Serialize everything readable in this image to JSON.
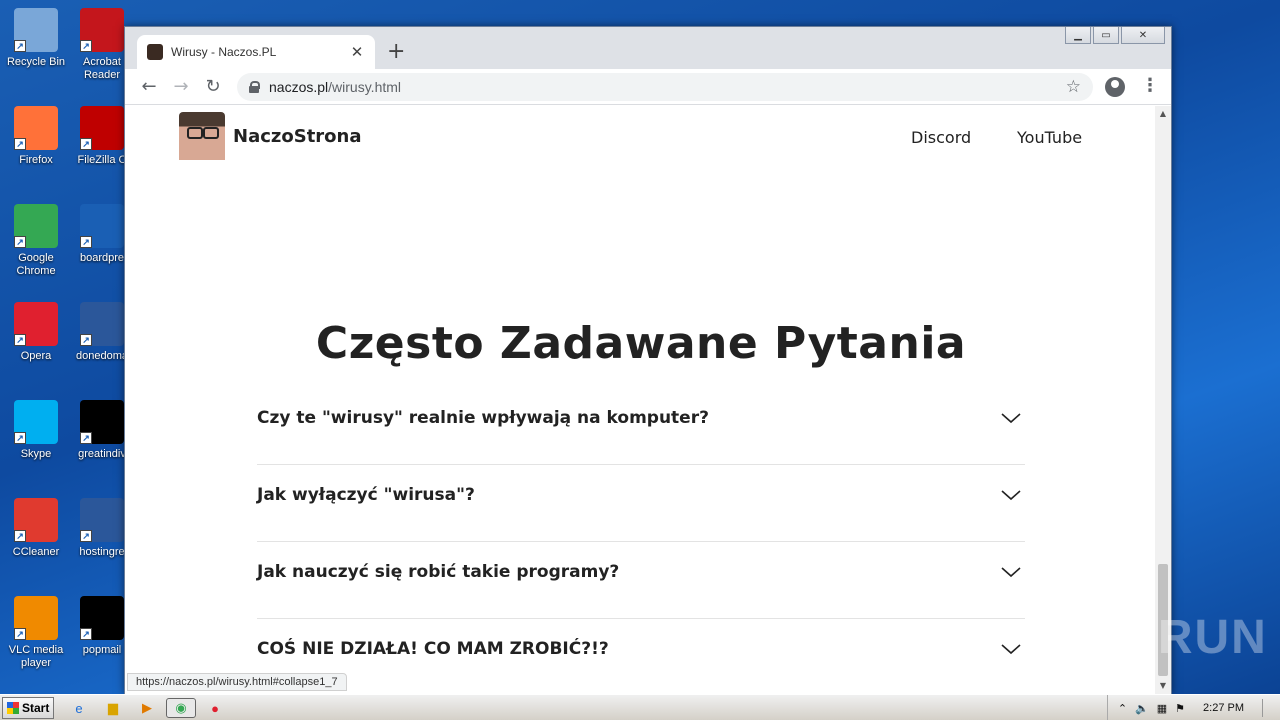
{
  "desktop": {
    "icons": [
      {
        "label": "Recycle Bin",
        "icon": "recycle-bin-icon",
        "color": "#7aa7d8"
      },
      {
        "label": "Acrobat Reader",
        "icon": "acrobat-icon",
        "color": "#c4161c"
      },
      {
        "label": "Firefox",
        "icon": "firefox-icon",
        "color": "#ff7139"
      },
      {
        "label": "FileZilla C",
        "icon": "filezilla-icon",
        "color": "#bf0000"
      },
      {
        "label": "Google Chrome",
        "icon": "chrome-icon",
        "color": "#34a853"
      },
      {
        "label": "boardpre",
        "icon": "blank-doc-icon",
        "color": "#1a5fb4"
      },
      {
        "label": "Opera",
        "icon": "opera-icon",
        "color": "#e0202f"
      },
      {
        "label": "donedoma",
        "icon": "word-icon",
        "color": "#2b579a"
      },
      {
        "label": "Skype",
        "icon": "skype-icon",
        "color": "#00aff0"
      },
      {
        "label": "greatindiv",
        "icon": "black-file-icon",
        "color": "#000000"
      },
      {
        "label": "CCleaner",
        "icon": "ccleaner-icon",
        "color": "#e03a2f"
      },
      {
        "label": "hostingre",
        "icon": "word-icon",
        "color": "#2b579a"
      },
      {
        "label": "VLC media player",
        "icon": "vlc-icon",
        "color": "#f08a00"
      },
      {
        "label": "popmail",
        "icon": "black-file-icon",
        "color": "#000000"
      }
    ]
  },
  "browser": {
    "tab_title": "Wirusy - Naczos.PL",
    "new_tab": "+",
    "tab_close": "✕",
    "url_host": "naczos.pl",
    "url_path": "/wirusy.html",
    "status_url": "https://naczos.pl/wirusy.html#collapse1_7"
  },
  "site": {
    "brand": "NaczoStrona",
    "nav": [
      "Discord",
      "YouTube"
    ],
    "faq_title": "Często Zadawane Pytania",
    "faq": [
      "Czy te \"wirusy\" realnie wpływają na komputer?",
      "Jak wyłączyć \"wirusa\"?",
      "Jak nauczyć się robić takie programy?",
      "COŚ NIE DZIAŁA! CO MAM ZROBIĆ?!?"
    ]
  },
  "watermark": "ANY RUN",
  "taskbar": {
    "start_label": "Start",
    "clock": "2:27 PM"
  }
}
